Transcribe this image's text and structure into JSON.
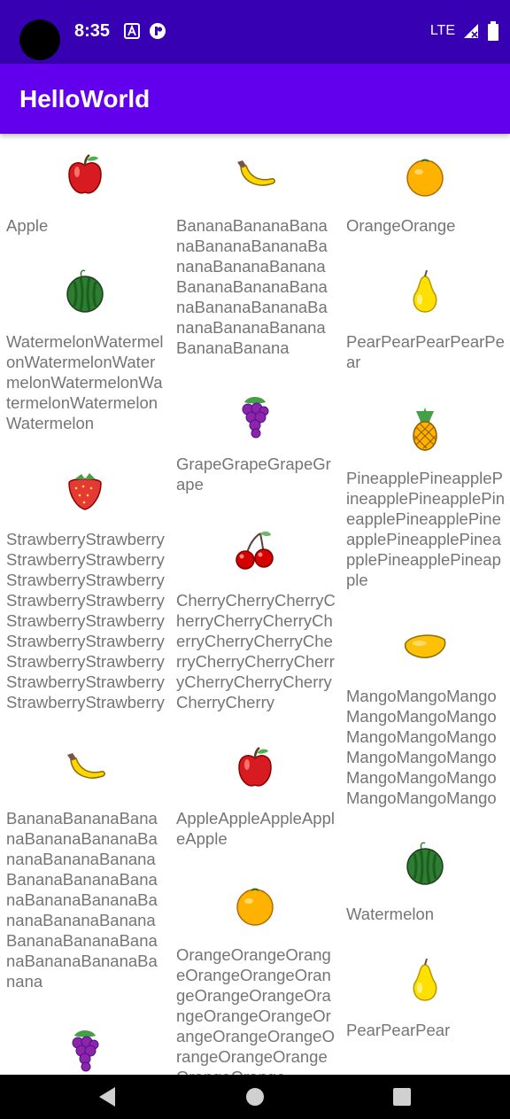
{
  "status_bar": {
    "time": "8:35",
    "network": "LTE",
    "notification_icons": [
      "text-notification-icon",
      "app-notification-icon"
    ],
    "right_icons": [
      "signal-icon",
      "battery-icon"
    ]
  },
  "app_bar": {
    "title": "HelloWorld",
    "color": "#6200ee",
    "status_color": "#3700b3"
  },
  "columns": [
    [
      {
        "icon": "apple-icon",
        "name": "Apple"
      },
      {
        "icon": "watermelon-icon",
        "name": "WatermelonWatermelonWatermelonWatermelonWatermelonWatermelonWatermelonWatermelon"
      },
      {
        "icon": "strawberry-icon",
        "name": "StrawberryStrawberryStrawberryStrawberryStrawberryStrawberryStrawberryStrawberryStrawberryStrawberryStrawberryStrawberryStrawberryStrawberryStrawberryStrawberryStrawberryStrawberry"
      },
      {
        "icon": "banana-icon",
        "name": "BananaBananaBananaBananaBananaBananaBananaBananaBananaBananaBananaBananaBananaBananaBananaBananaBananaBananaBananaBananaBananaBanana"
      },
      {
        "icon": "grape-icon",
        "name": ""
      }
    ],
    [
      {
        "icon": "banana-icon",
        "name": "BananaBananaBananaBananaBananaBananaBananaBananaBananaBananaBananaBananaBananaBananaBananaBananaBananaBanana"
      },
      {
        "icon": "grape-icon",
        "name": "GrapeGrapeGrapeGrape"
      },
      {
        "icon": "cherry-icon",
        "name": "CherryCherryCherryCherryCherryCherryCherryCherryCherryCherryCherryCherryCherryCherryCherryCherryCherryCherry"
      },
      {
        "icon": "apple-icon",
        "name": "AppleAppleAppleAppleApple"
      },
      {
        "icon": "orange-icon",
        "name": "OrangeOrangeOrangeOrangeOrangeOrangeOrangeOrangeOrangeOrangeOrangeOrangeOrangeOrangeOrangeOrangeOrangeOrangeOrange"
      }
    ],
    [
      {
        "icon": "orange-icon",
        "name": "OrangeOrange"
      },
      {
        "icon": "pear-icon",
        "name": "PearPearPearPearPear"
      },
      {
        "icon": "pineapple-icon",
        "name": "PineapplePineapplePineapplePineapplePineapplePineapplePineapplePineapplePineapplePineapplePineapple"
      },
      {
        "icon": "mango-icon",
        "name": "MangoMangoMangoMangoMangoMangoMangoMangoMangoMangoMangoMangoMangoMangoMangoMangoMangoMango"
      },
      {
        "icon": "watermelon-icon",
        "name": "Watermelon"
      },
      {
        "icon": "pear-icon",
        "name": "PearPearPear"
      },
      {
        "icon": "pineapple-icon",
        "name": ""
      }
    ]
  ]
}
